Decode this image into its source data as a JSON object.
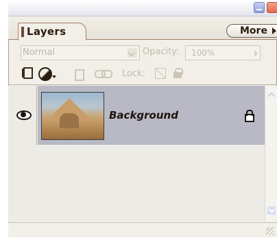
{
  "panel": {
    "tab_label": "Layers",
    "more_label": "More"
  },
  "options": {
    "blend_mode": "Normal",
    "opacity_label": "Opacity:",
    "opacity_value": "100%"
  },
  "toolbar": {
    "lock_label": "Lock:"
  },
  "layers": [
    {
      "name": "Background",
      "visible": true,
      "locked": true,
      "selected": true
    }
  ]
}
